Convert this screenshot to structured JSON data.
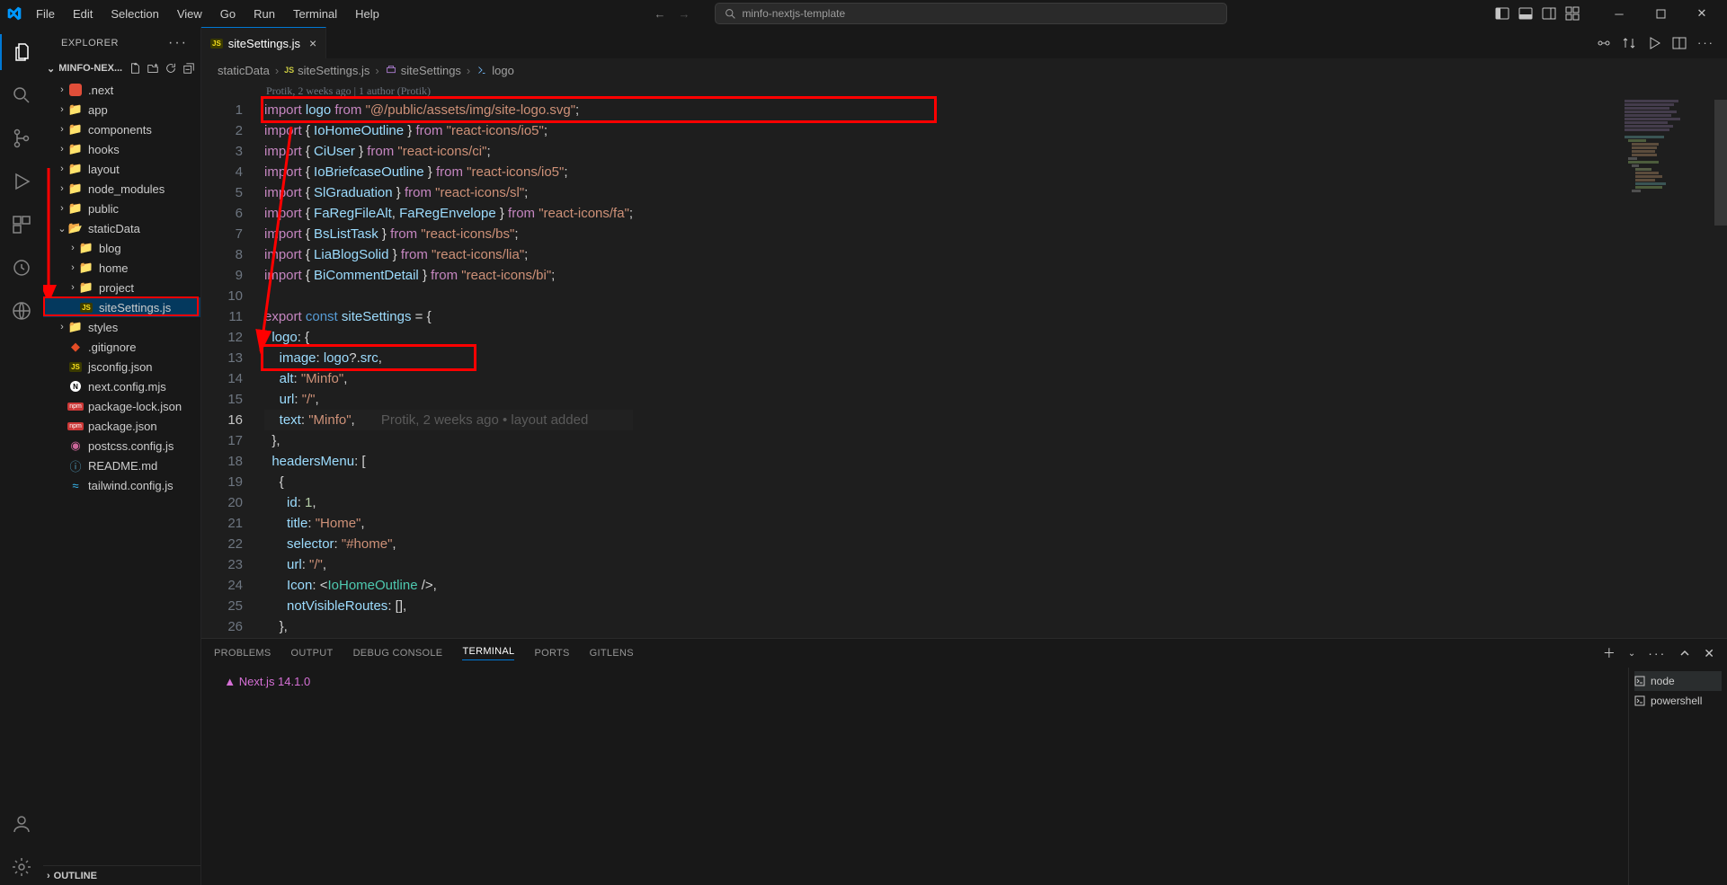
{
  "titlebar": {
    "menu": [
      "File",
      "Edit",
      "Selection",
      "View",
      "Go",
      "Run",
      "Terminal",
      "Help"
    ],
    "search_text": "minfo-nextjs-template"
  },
  "sidebar": {
    "title": "EXPLORER",
    "root": "MINFO-NEX...",
    "tree": [
      {
        "depth": 0,
        "chev": "right",
        "icon": "next",
        "label": ".next"
      },
      {
        "depth": 0,
        "chev": "right",
        "icon": "folder-g",
        "label": "app"
      },
      {
        "depth": 0,
        "chev": "right",
        "icon": "folder",
        "label": "components"
      },
      {
        "depth": 0,
        "chev": "right",
        "icon": "folder-r",
        "label": "hooks"
      },
      {
        "depth": 0,
        "chev": "right",
        "icon": "folder-r",
        "label": "layout"
      },
      {
        "depth": 0,
        "chev": "right",
        "icon": "folder-g",
        "label": "node_modules"
      },
      {
        "depth": 0,
        "chev": "right",
        "icon": "folder",
        "label": "public"
      },
      {
        "depth": 0,
        "chev": "down",
        "icon": "folder-open",
        "label": "staticData"
      },
      {
        "depth": 1,
        "chev": "right",
        "icon": "folder",
        "label": "blog"
      },
      {
        "depth": 1,
        "chev": "right",
        "icon": "folder",
        "label": "home"
      },
      {
        "depth": 1,
        "chev": "right",
        "icon": "folder",
        "label": "project"
      },
      {
        "depth": 1,
        "chev": "",
        "icon": "js",
        "label": "siteSettings.js",
        "selected": true
      },
      {
        "depth": 0,
        "chev": "right",
        "icon": "folder-b",
        "label": "styles"
      },
      {
        "depth": 0,
        "chev": "",
        "icon": "git",
        "label": ".gitignore"
      },
      {
        "depth": 0,
        "chev": "",
        "icon": "js",
        "label": "jsconfig.json"
      },
      {
        "depth": 0,
        "chev": "",
        "icon": "next-cfg",
        "label": "next.config.mjs"
      },
      {
        "depth": 0,
        "chev": "",
        "icon": "npm",
        "label": "package-lock.json"
      },
      {
        "depth": 0,
        "chev": "",
        "icon": "npm",
        "label": "package.json"
      },
      {
        "depth": 0,
        "chev": "",
        "icon": "postcss",
        "label": "postcss.config.js"
      },
      {
        "depth": 0,
        "chev": "",
        "icon": "readme",
        "label": "README.md"
      },
      {
        "depth": 0,
        "chev": "",
        "icon": "tailwind",
        "label": "tailwind.config.js"
      }
    ],
    "outline": "OUTLINE"
  },
  "tab": {
    "label": "siteSettings.js"
  },
  "breadcrumb": [
    "staticData",
    "siteSettings.js",
    "siteSettings",
    "logo"
  ],
  "codelens": "Protik, 2 weeks ago | 1 author (Protik)",
  "code": {
    "lines": [
      {
        "n": 1,
        "html": "<span class='tok-kw'>import</span> <span class='tok-var'>logo</span> <span class='tok-kw'>from</span> <span class='tok-str'>\"@/public/assets/img/site-logo.svg\"</span><span class='tok-punc'>;</span>"
      },
      {
        "n": 2,
        "html": "<span class='tok-kw'>import</span> <span class='tok-punc'>{</span> <span class='tok-var'>IoHomeOutline</span> <span class='tok-punc'>}</span> <span class='tok-kw'>from</span> <span class='tok-str'>\"react-icons/io5\"</span><span class='tok-punc'>;</span>"
      },
      {
        "n": 3,
        "html": "<span class='tok-kw'>import</span> <span class='tok-punc'>{</span> <span class='tok-var'>CiUser</span> <span class='tok-punc'>}</span> <span class='tok-kw'>from</span> <span class='tok-str'>\"react-icons/ci\"</span><span class='tok-punc'>;</span>"
      },
      {
        "n": 4,
        "html": "<span class='tok-kw'>import</span> <span class='tok-punc'>{</span> <span class='tok-var'>IoBriefcaseOutline</span> <span class='tok-punc'>}</span> <span class='tok-kw'>from</span> <span class='tok-str'>\"react-icons/io5\"</span><span class='tok-punc'>;</span>"
      },
      {
        "n": 5,
        "html": "<span class='tok-kw'>import</span> <span class='tok-punc'>{</span> <span class='tok-var'>SlGraduation</span> <span class='tok-punc'>}</span> <span class='tok-kw'>from</span> <span class='tok-str'>\"react-icons/sl\"</span><span class='tok-punc'>;</span>"
      },
      {
        "n": 6,
        "html": "<span class='tok-kw'>import</span> <span class='tok-punc'>{</span> <span class='tok-var'>FaRegFileAlt</span><span class='tok-punc'>,</span> <span class='tok-var'>FaRegEnvelope</span> <span class='tok-punc'>}</span> <span class='tok-kw'>from</span> <span class='tok-str'>\"react-icons/fa\"</span><span class='tok-punc'>;</span>"
      },
      {
        "n": 7,
        "html": "<span class='tok-kw'>import</span> <span class='tok-punc'>{</span> <span class='tok-var'>BsListTask</span> <span class='tok-punc'>}</span> <span class='tok-kw'>from</span> <span class='tok-str'>\"react-icons/bs\"</span><span class='tok-punc'>;</span>"
      },
      {
        "n": 8,
        "html": "<span class='tok-kw'>import</span> <span class='tok-punc'>{</span> <span class='tok-var'>LiaBlogSolid</span> <span class='tok-punc'>}</span> <span class='tok-kw'>from</span> <span class='tok-str'>\"react-icons/lia\"</span><span class='tok-punc'>;</span>"
      },
      {
        "n": 9,
        "html": "<span class='tok-kw'>import</span> <span class='tok-punc'>{</span> <span class='tok-var'>BiCommentDetail</span> <span class='tok-punc'>}</span> <span class='tok-kw'>from</span> <span class='tok-str'>\"react-icons/bi\"</span><span class='tok-punc'>;</span>"
      },
      {
        "n": 10,
        "html": ""
      },
      {
        "n": 11,
        "html": "<span class='tok-kw'>export</span> <span class='tok-const'>const</span> <span class='tok-var'>siteSettings</span> <span class='tok-op'>=</span> <span class='tok-punc'>{</span>"
      },
      {
        "n": 12,
        "html": "  <span class='tok-prop'>logo</span><span class='tok-punc'>:</span> <span class='tok-punc'>{</span>"
      },
      {
        "n": 13,
        "html": "    <span class='tok-prop'>image</span><span class='tok-punc'>:</span> <span class='tok-var'>logo</span><span class='tok-punc'>?.</span><span class='tok-var'>src</span><span class='tok-punc'>,</span>"
      },
      {
        "n": 14,
        "html": "    <span class='tok-prop'>alt</span><span class='tok-punc'>:</span> <span class='tok-str'>\"Minfo\"</span><span class='tok-punc'>,</span>"
      },
      {
        "n": 15,
        "html": "    <span class='tok-prop'>url</span><span class='tok-punc'>:</span> <span class='tok-str'>\"/\"</span><span class='tok-punc'>,</span>"
      },
      {
        "n": 16,
        "html": "    <span class='tok-prop'>text</span><span class='tok-punc'>:</span> <span class='tok-str'>\"Minfo\"</span><span class='tok-punc'>,</span>       <span class='blame'>Protik, 2 weeks ago • layout added</span>",
        "current": true
      },
      {
        "n": 17,
        "html": "  <span class='tok-punc'>},</span>"
      },
      {
        "n": 18,
        "html": "  <span class='tok-prop'>headersMenu</span><span class='tok-punc'>:</span> <span class='tok-punc'>[</span>"
      },
      {
        "n": 19,
        "html": "    <span class='tok-punc'>{</span>"
      },
      {
        "n": 20,
        "html": "      <span class='tok-prop'>id</span><span class='tok-punc'>:</span> <span class='tok-num'>1</span><span class='tok-punc'>,</span>"
      },
      {
        "n": 21,
        "html": "      <span class='tok-prop'>title</span><span class='tok-punc'>:</span> <span class='tok-str'>\"Home\"</span><span class='tok-punc'>,</span>"
      },
      {
        "n": 22,
        "html": "      <span class='tok-prop'>selector</span><span class='tok-punc'>:</span> <span class='tok-str'>\"#home\"</span><span class='tok-punc'>,</span>"
      },
      {
        "n": 23,
        "html": "      <span class='tok-prop'>url</span><span class='tok-punc'>:</span> <span class='tok-str'>\"/\"</span><span class='tok-punc'>,</span>"
      },
      {
        "n": 24,
        "html": "      <span class='tok-prop'>Icon</span><span class='tok-punc'>:</span> <span class='tok-punc'>&lt;</span><span class='tok-type'>IoHomeOutline</span> <span class='tok-punc'>/&gt;,</span>"
      },
      {
        "n": 25,
        "html": "      <span class='tok-prop'>notVisibleRoutes</span><span class='tok-punc'>:</span> <span class='tok-punc'>[],</span>"
      },
      {
        "n": 26,
        "html": "    <span class='tok-punc'>},</span>"
      }
    ]
  },
  "panel": {
    "tabs": [
      "PROBLEMS",
      "OUTPUT",
      "DEBUG CONSOLE",
      "TERMINAL",
      "PORTS",
      "GITLENS"
    ],
    "active": "TERMINAL",
    "terminal_line": "▲ Next.js 14.1.0",
    "terminals": [
      "node",
      "powershell"
    ]
  }
}
